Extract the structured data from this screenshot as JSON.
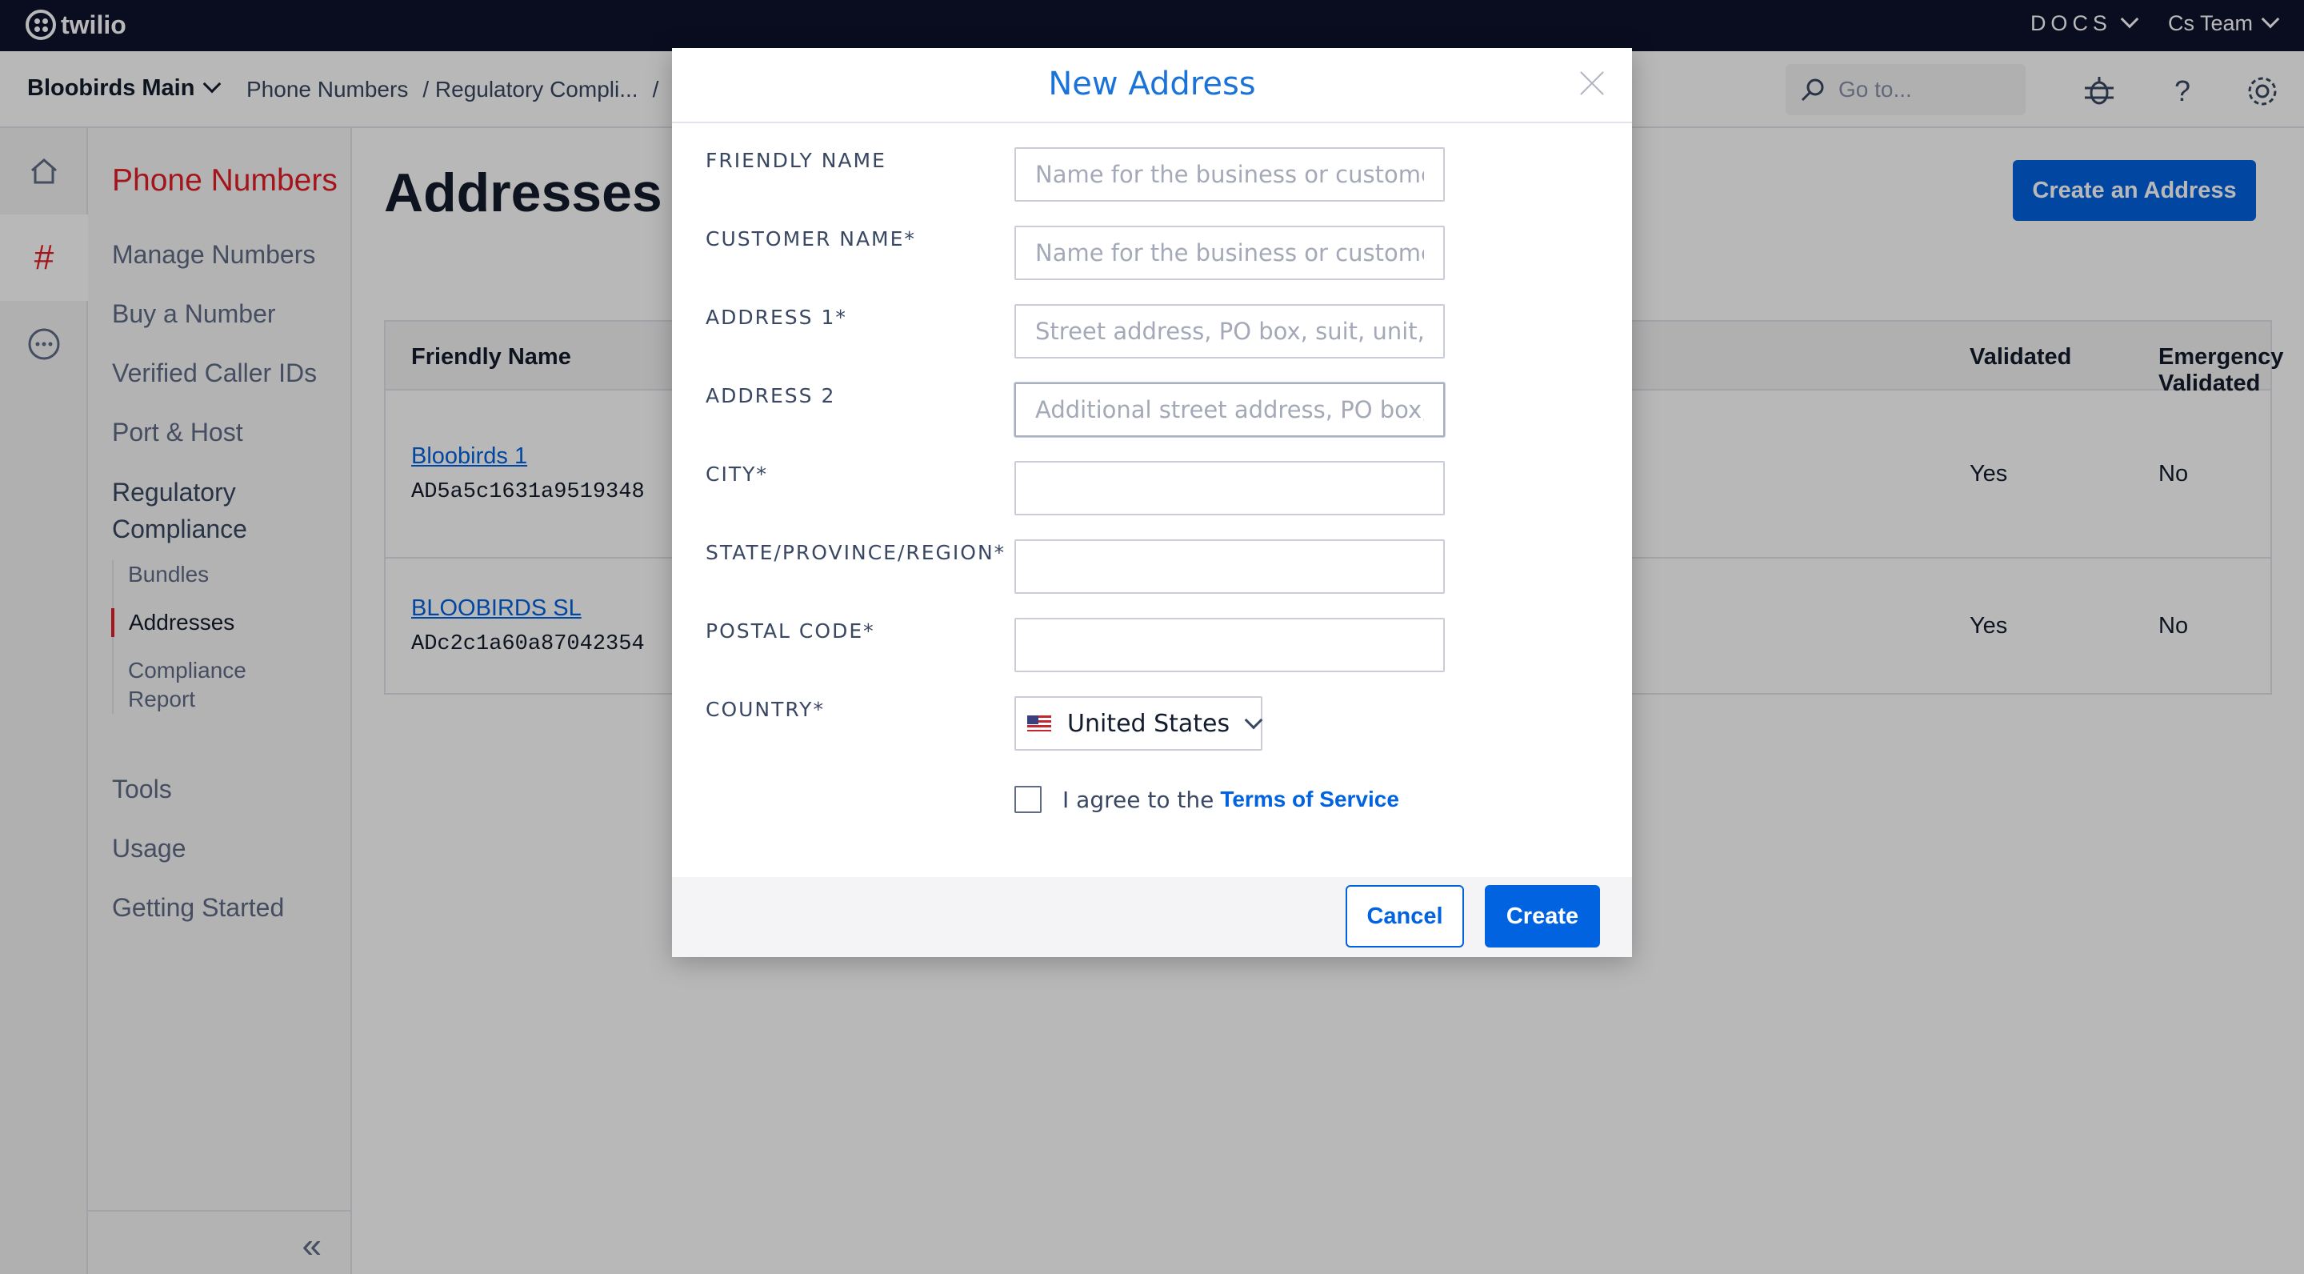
{
  "topbar": {
    "logo_text": "twilio",
    "docs_label": "DOCS",
    "account_label": "Cs Team"
  },
  "subbar": {
    "account_name": "Bloobirds Main",
    "breadcrumbs": [
      "Phone Numbers",
      "/ Regulatory Compli...",
      "/"
    ],
    "goto_placeholder": "Go to..."
  },
  "nav": {
    "title": "Phone Numbers",
    "items": [
      "Manage Numbers",
      "Buy a Number",
      "Verified Caller IDs",
      "Port & Host"
    ],
    "section": "Regulatory Compliance",
    "sub_items": [
      "Bundles",
      "Addresses",
      "Compliance Report"
    ],
    "bottom_items": [
      "Tools",
      "Usage",
      "Getting Started"
    ]
  },
  "main": {
    "title": "Addresses",
    "create_button": "Create an Address",
    "columns": [
      "Friendly Name",
      "Validated",
      "Emergency Validated"
    ],
    "rows": [
      {
        "name": "Bloobirds 1",
        "sid": "AD5a5c1631a9519348",
        "validated": "Yes",
        "emergency": "No"
      },
      {
        "name": "BLOOBIRDS SL",
        "sid": "ADc2c1a60a87042354",
        "validated": "Yes",
        "emergency": "No"
      }
    ]
  },
  "modal": {
    "title": "New Address",
    "fields": [
      {
        "label": "FRIENDLY NAME",
        "placeholder": "Name for the business or customer",
        "value": ""
      },
      {
        "label": "CUSTOMER NAME*",
        "placeholder": "Name for the business or customer",
        "value": ""
      },
      {
        "label": "ADDRESS 1*",
        "placeholder": "Street address, PO box, suit, unit, et",
        "value": ""
      },
      {
        "label": "ADDRESS 2",
        "placeholder": "Additional street address, PO box, s",
        "value": ""
      },
      {
        "label": "CITY*",
        "placeholder": "",
        "value": ""
      },
      {
        "label": "STATE/PROVINCE/REGION*",
        "placeholder": "",
        "value": ""
      },
      {
        "label": "POSTAL CODE*",
        "placeholder": "",
        "value": ""
      }
    ],
    "country_label": "COUNTRY*",
    "country_value": "United States",
    "agree_text": "I agree to the",
    "terms_link": "Terms of Service",
    "cancel_label": "Cancel",
    "create_label": "Create"
  },
  "colors": {
    "accent_blue": "#0263e0",
    "brand_red": "#e31e26",
    "topbar_bg": "#0d122b"
  }
}
